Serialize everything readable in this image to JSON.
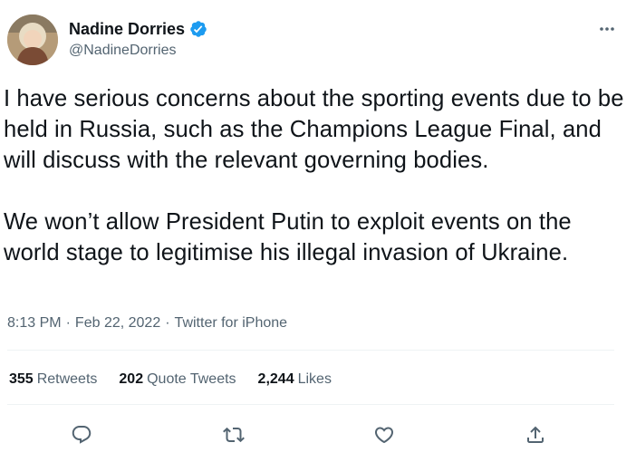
{
  "author": {
    "display_name": "Nadine Dorries",
    "handle": "@NadineDorries",
    "verified": true,
    "verified_color": "#1d9bf0"
  },
  "tweet": {
    "paragraphs": [
      "I have serious concerns about the sporting events due to be held in Russia, such as the Champions League Final, and will discuss with the relevant governing bodies.",
      "We won’t allow President Putin to exploit events on the world stage to legitimise his illegal invasion of Ukraine."
    ]
  },
  "meta": {
    "time": "8:13 PM",
    "date": "Feb 22, 2022",
    "source": "Twitter for iPhone",
    "separator": "·"
  },
  "stats": {
    "retweets_count": "355",
    "retweets_label": "Retweets",
    "quotes_count": "202",
    "quotes_label": "Quote Tweets",
    "likes_count": "2,244",
    "likes_label": "Likes"
  },
  "actions": [
    "reply-icon",
    "retweet-icon",
    "like-icon",
    "share-icon"
  ],
  "colors": {
    "text": "#0f1419",
    "secondary": "#536471",
    "divider": "#eff3f4"
  }
}
